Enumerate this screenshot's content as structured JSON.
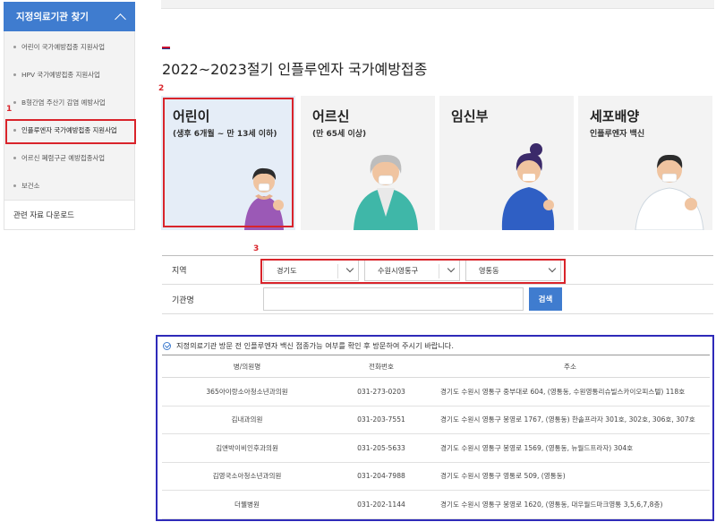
{
  "sidebar": {
    "title": "지정의료기관 찾기",
    "items": [
      {
        "label": "어린이 국가예방접종 지원사업"
      },
      {
        "label": "HPV 국가예방접종 지원사업"
      },
      {
        "label": "B형간염 주산기 감염 예방사업"
      },
      {
        "label": "인플루엔자 국가예방접종 지원사업"
      },
      {
        "label": "어르신 폐렴구균 예방접종사업"
      },
      {
        "label": "보건소"
      }
    ],
    "footer": "관련 자료 다운로드"
  },
  "markers": {
    "m1": "1",
    "m2": "2",
    "m3": "3"
  },
  "page_title": "2022~2023절기 인플루엔자 국가예방접종",
  "cards": [
    {
      "title": "어린이",
      "subtitle": "(생후 6개월 ~ 만 13세 이하)"
    },
    {
      "title": "어르신",
      "subtitle": "(만 65세 이상)"
    },
    {
      "title": "임신부",
      "subtitle": ""
    },
    {
      "title": "세포배양",
      "subtitle": "인플루엔자 백신"
    }
  ],
  "form": {
    "region_label": "지역",
    "region1": "경기도",
    "region2": "수원시영통구",
    "region3": "영통동",
    "name_label": "기관명",
    "search_button": "검색"
  },
  "results": {
    "notice": "지정의료기관 방문 전 인플루엔자 백신 접종가능 여부를 확인 후 방문하여 주시기 바랍니다.",
    "headers": [
      "병/의원명",
      "전화번호",
      "주소"
    ],
    "rows": [
      {
        "name": "365아이랑소아청소년과의원",
        "phone": "031-273-0203",
        "address": "경기도 수원시 영통구 중부대로 604, (영통동, 수원영통리슈빌스카이오피스텔) 118호"
      },
      {
        "name": "김내과의원",
        "phone": "031-203-7551",
        "address": "경기도 수원시 영통구 봉영로 1767, (영통동) 한솔프라자 301호, 302호, 306호, 307호"
      },
      {
        "name": "김앤박이비인후과의원",
        "phone": "031-205-5633",
        "address": "경기도 수원시 영통구 봉영로 1569, (영통동, 뉴월드프라자) 304호"
      },
      {
        "name": "김영국소아청소년과의원",
        "phone": "031-204-7988",
        "address": "경기도 수원시 영통구 영통로 509, (영통동)"
      },
      {
        "name": "더웰병원",
        "phone": "031-202-1144",
        "address": "경기도 수원시 영통구 봉영로 1620, (영통동, 대우월드마크영통 3,5,6,7,8층)"
      }
    ]
  },
  "colors": {
    "accent": "#3f7ccf",
    "highlight_red": "#d9242b",
    "outline_blue": "#2e2ab9"
  }
}
